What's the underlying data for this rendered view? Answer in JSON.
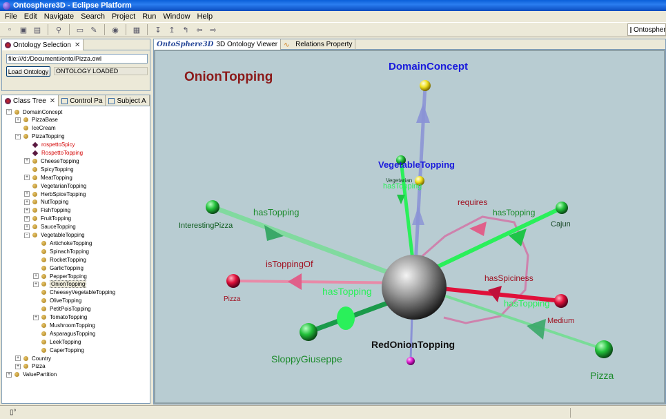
{
  "window": {
    "title": "Ontosphere3D - Eclipse Platform"
  },
  "menu": [
    "File",
    "Edit",
    "Navigate",
    "Search",
    "Project",
    "Run",
    "Window",
    "Help"
  ],
  "perspective": {
    "label": "Ontospher"
  },
  "ontology_view": {
    "tab": "Ontology Selection",
    "file_value": "file:///d:/Documenti/onto/Pizza.owl",
    "load_label": "Load Ontology",
    "status": "ONTOLOGY LOADED"
  },
  "tree_view": {
    "tabs": [
      "Class Tree",
      "Control Pa",
      "Subject A"
    ],
    "items": [
      {
        "label": "DomainConcept",
        "level": 0,
        "exp": "-",
        "kind": "class"
      },
      {
        "label": "PizzaBase",
        "level": 1,
        "exp": "+",
        "kind": "class"
      },
      {
        "label": "IceCream",
        "level": 1,
        "exp": "",
        "kind": "class"
      },
      {
        "label": "PizzaTopping",
        "level": 1,
        "exp": "-",
        "kind": "class"
      },
      {
        "label": "rospettoSpicy",
        "level": 2,
        "exp": "",
        "kind": "individual"
      },
      {
        "label": "RospettoTopping",
        "level": 2,
        "exp": "",
        "kind": "individual"
      },
      {
        "label": "CheeseTopping",
        "level": 2,
        "exp": "+",
        "kind": "class"
      },
      {
        "label": "SpicyTopping",
        "level": 2,
        "exp": "",
        "kind": "class"
      },
      {
        "label": "MeatTopping",
        "level": 2,
        "exp": "+",
        "kind": "class"
      },
      {
        "label": "VegetarianTopping",
        "level": 2,
        "exp": "",
        "kind": "class"
      },
      {
        "label": "HerbSpiceTopping",
        "level": 2,
        "exp": "+",
        "kind": "class"
      },
      {
        "label": "NutTopping",
        "level": 2,
        "exp": "+",
        "kind": "class"
      },
      {
        "label": "FishTopping",
        "level": 2,
        "exp": "+",
        "kind": "class"
      },
      {
        "label": "FruitTopping",
        "level": 2,
        "exp": "+",
        "kind": "class"
      },
      {
        "label": "SauceTopping",
        "level": 2,
        "exp": "+",
        "kind": "class"
      },
      {
        "label": "VegetableTopping",
        "level": 2,
        "exp": "-",
        "kind": "class"
      },
      {
        "label": "ArtichokeTopping",
        "level": 3,
        "exp": "",
        "kind": "class"
      },
      {
        "label": "SpinachTopping",
        "level": 3,
        "exp": "",
        "kind": "class"
      },
      {
        "label": "RocketTopping",
        "level": 3,
        "exp": "",
        "kind": "class"
      },
      {
        "label": "GarlicTopping",
        "level": 3,
        "exp": "",
        "kind": "class"
      },
      {
        "label": "PepperTopping",
        "level": 3,
        "exp": "+",
        "kind": "class"
      },
      {
        "label": "OnionTopping",
        "level": 3,
        "exp": "+",
        "kind": "class",
        "selected": true
      },
      {
        "label": "CheeseyVegetableTopping",
        "level": 3,
        "exp": "",
        "kind": "class"
      },
      {
        "label": "OliveTopping",
        "level": 3,
        "exp": "",
        "kind": "class"
      },
      {
        "label": "PetitPoisTopping",
        "level": 3,
        "exp": "",
        "kind": "class"
      },
      {
        "label": "TomatoTopping",
        "level": 3,
        "exp": "+",
        "kind": "class"
      },
      {
        "label": "MushroomTopping",
        "level": 3,
        "exp": "",
        "kind": "class"
      },
      {
        "label": "AsparagusTopping",
        "level": 3,
        "exp": "",
        "kind": "class"
      },
      {
        "label": "LeekTopping",
        "level": 3,
        "exp": "",
        "kind": "class"
      },
      {
        "label": "CaperTopping",
        "level": 3,
        "exp": "",
        "kind": "class"
      },
      {
        "label": "Country",
        "level": 1,
        "exp": "+",
        "kind": "class"
      },
      {
        "label": "Pizza",
        "level": 1,
        "exp": "+",
        "kind": "class"
      },
      {
        "label": "ValuePartition",
        "level": 0,
        "exp": "+",
        "kind": "class"
      }
    ]
  },
  "viewer": {
    "tabs": [
      "OntoSphere3D",
      "3D Ontology Viewer",
      "Relations Property"
    ],
    "scene": {
      "title": "OnionTopping",
      "center_label": "RedOnionTopping",
      "node_labels": {
        "domain": "DomainConcept",
        "vegetable": "VegetableTopping",
        "vegetarian": "Vegetarian",
        "interesting": "InterestingPizza",
        "cajun": "Cajun",
        "pizza_left": "Pizza",
        "medium": "Medium",
        "sloppy": "SloppyGiuseppe",
        "pizza_right": "Pizza"
      },
      "edge_labels": {
        "hasTopping_veg": "hasTopping",
        "hasTopping_interesting": "hasTopping",
        "requires": "requires",
        "hasTopping_cajun": "hasTopping",
        "isToppingOf": "isToppingOf",
        "hasSpiciness": "hasSpiciness",
        "hasTopping_sloppy": "hasTopping",
        "hasTopping_pizza": "hasTopping"
      },
      "colors": {
        "background": "#b8ccd2",
        "title": "#8b1a1a",
        "class_label": "#1a1adc",
        "green_label": "#1a8a2a",
        "red_label": "#a01020",
        "green_node": "#22c03a",
        "red_node": "#e0103a",
        "yellow_node": "#f0e020",
        "magenta_node": "#e020d0",
        "blue_edge": "#8a92d6",
        "green_edge": "#2af05a",
        "pink_edge": "#d07aa8",
        "red_edge": "#e0103a"
      }
    }
  }
}
